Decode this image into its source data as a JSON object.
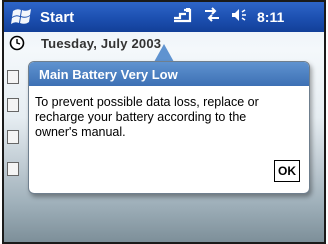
{
  "titlebar": {
    "start_label": "Start",
    "clock": "8:11",
    "icons": [
      "windows-flag-icon",
      "signal-icon",
      "connectivity-icon",
      "speaker-icon"
    ]
  },
  "today": {
    "date": "Tuesday, July 2003",
    "icons": [
      "clock-icon",
      "today-item-icon"
    ]
  },
  "dialog": {
    "title": "Main Battery Very Low",
    "message": "To prevent possible data loss, replace or recharge your battery according to the owner's manual.",
    "ok_label": "OK"
  },
  "colors": {
    "titlebar": "#1c4fb0",
    "dialog_title": "#4a7ec0",
    "dialog_border": "#6f7f8e"
  }
}
